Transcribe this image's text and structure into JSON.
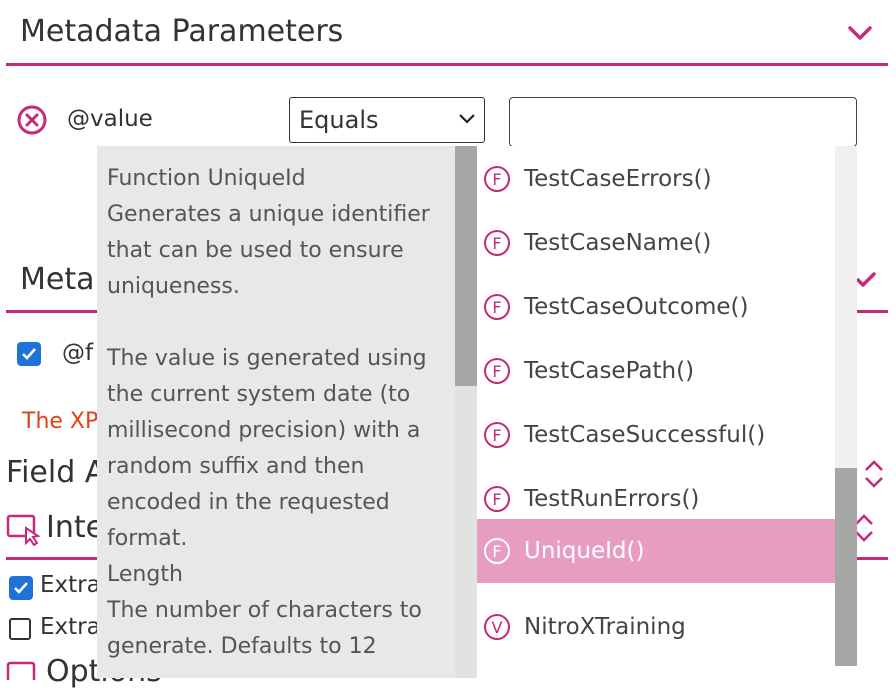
{
  "section1": {
    "title": "Metadata Parameters"
  },
  "param_row": {
    "name": "@value",
    "operator": "Equals",
    "value": ""
  },
  "section2": {
    "title_partial": "Meta"
  },
  "row2": {
    "name_partial": "@f"
  },
  "error_partial": "The XP",
  "field_section": {
    "title_partial": "Field A"
  },
  "inte_section": {
    "title_partial": "Inte"
  },
  "extra1": {
    "label_partial": "Extra",
    "checked": true
  },
  "extra2": {
    "label_partial": "Extra",
    "checked": false
  },
  "options_section": {
    "title_partial": "Options"
  },
  "tooltip": {
    "heading": "Function UniqueId",
    "desc1": "Generates a unique identifier that can be used to ensure uniqueness.",
    "desc2": "The value is generated using the current system date (to millisecond precision) with a random suffix and then encoded in the requested format.",
    "param_name": "Length",
    "param_desc": "The number of characters to generate. Defaults to 12"
  },
  "list": {
    "items": [
      {
        "badge": "F",
        "label": "TestCaseErrors()"
      },
      {
        "badge": "F",
        "label": "TestCaseName()"
      },
      {
        "badge": "F",
        "label": "TestCaseOutcome()"
      },
      {
        "badge": "F",
        "label": "TestCasePath()"
      },
      {
        "badge": "F",
        "label": "TestCaseSuccessful()"
      },
      {
        "badge": "F",
        "label": "TestRunErrors()"
      },
      {
        "badge": "F",
        "label": "UniqueId()",
        "selected": true
      },
      {
        "badge": "V",
        "label": "NitroXTraining"
      }
    ]
  },
  "colors": {
    "accent": "#c8287a",
    "selected_bg": "#e79dc2",
    "checkbox": "#1f73d8",
    "error": "#e0401a"
  }
}
